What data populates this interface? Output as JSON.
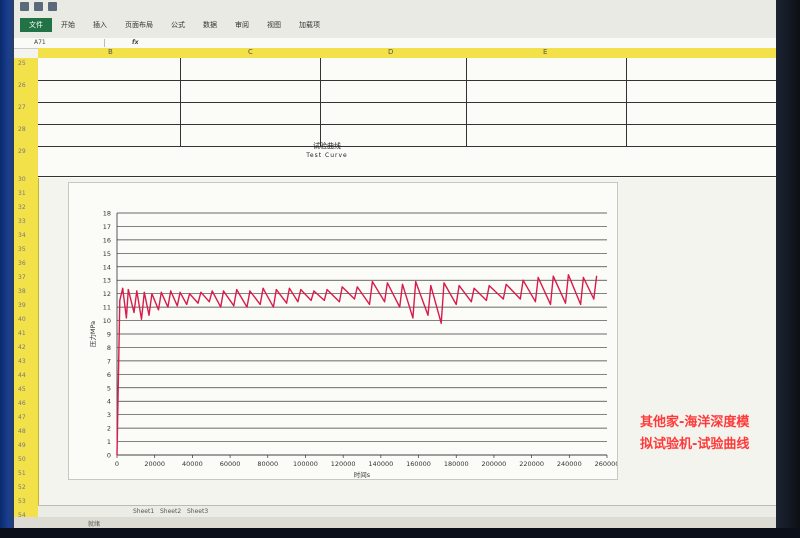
{
  "ribbon": {
    "tabs": [
      "文件",
      "开始",
      "插入",
      "页面布局",
      "公式",
      "数据",
      "审阅",
      "视图",
      "加载项"
    ]
  },
  "formula_bar": {
    "name_box": "A71",
    "fx": "fx"
  },
  "columns": [
    "B",
    "C",
    "D",
    "E"
  ],
  "rows": [
    "25",
    "26",
    "27",
    "28",
    "29",
    "30",
    "31",
    "32",
    "33",
    "34",
    "35",
    "36",
    "37",
    "38",
    "39",
    "40",
    "41",
    "42",
    "43",
    "44",
    "45",
    "46",
    "47",
    "48",
    "49",
    "50",
    "51",
    "52",
    "53",
    "54"
  ],
  "curve": {
    "title_cn": "试验曲线",
    "title_en": "Test Curve"
  },
  "sheets": [
    "Sheet1",
    "Sheet2",
    "Sheet3"
  ],
  "status": {
    "ready": "就绪"
  },
  "watermark": {
    "line1": "其他家-海洋深度模",
    "line2": "拟试验机-试验曲线"
  },
  "colors": {
    "line": "#d81b4a",
    "header": "#f3e14a",
    "watermark": "#ff3a3a"
  },
  "chart_data": {
    "type": "line",
    "ylabel": "压力MPa",
    "xlabel": "时间s",
    "ylim": [
      0,
      18
    ],
    "xlim": [
      0,
      260000
    ],
    "yticks": [
      "0",
      "1",
      "2",
      "3",
      "4",
      "5",
      "6",
      "7",
      "8",
      "9",
      "10",
      "11",
      "12",
      "13",
      "14",
      "15",
      "16",
      "17",
      "18"
    ],
    "xticks": [
      "0",
      "20000",
      "40000",
      "60000",
      "80000",
      "100000",
      "120000",
      "140000",
      "160000",
      "180000",
      "200000",
      "220000",
      "240000",
      "260000"
    ],
    "series": [
      {
        "values": [
          [
            0,
            0
          ],
          [
            1500,
            11.5
          ],
          [
            3000,
            12.4
          ],
          [
            5000,
            10.2
          ],
          [
            6000,
            12.3
          ],
          [
            9000,
            10.6
          ],
          [
            10500,
            12.2
          ],
          [
            13000,
            10.1
          ],
          [
            14500,
            12.1
          ],
          [
            17000,
            10.4
          ],
          [
            18500,
            12.0
          ],
          [
            22000,
            10.8
          ],
          [
            23500,
            12.1
          ],
          [
            27000,
            11.0
          ],
          [
            28500,
            12.2
          ],
          [
            32000,
            11.1
          ],
          [
            33500,
            12.1
          ],
          [
            37000,
            11.2
          ],
          [
            38500,
            12.0
          ],
          [
            43000,
            11.3
          ],
          [
            44500,
            12.1
          ],
          [
            49000,
            11.4
          ],
          [
            50500,
            12.2
          ],
          [
            55000,
            11.0
          ],
          [
            56500,
            12.2
          ],
          [
            62000,
            11.1
          ],
          [
            63500,
            12.3
          ],
          [
            69000,
            11.0
          ],
          [
            70500,
            12.2
          ],
          [
            76000,
            11.2
          ],
          [
            77500,
            12.4
          ],
          [
            83000,
            11.0
          ],
          [
            84500,
            12.3
          ],
          [
            90000,
            11.3
          ],
          [
            91500,
            12.4
          ],
          [
            96000,
            11.4
          ],
          [
            97500,
            12.3
          ],
          [
            103000,
            11.5
          ],
          [
            104500,
            12.2
          ],
          [
            110000,
            11.5
          ],
          [
            111500,
            12.3
          ],
          [
            118000,
            11.4
          ],
          [
            119500,
            12.5
          ],
          [
            126000,
            11.6
          ],
          [
            127500,
            12.5
          ],
          [
            134000,
            11.2
          ],
          [
            135500,
            12.9
          ],
          [
            142000,
            11.4
          ],
          [
            143500,
            12.8
          ],
          [
            150000,
            11.0
          ],
          [
            151500,
            12.7
          ],
          [
            157000,
            10.2
          ],
          [
            158500,
            12.9
          ],
          [
            165000,
            10.4
          ],
          [
            166500,
            12.6
          ],
          [
            172000,
            9.8
          ],
          [
            173500,
            12.8
          ],
          [
            180000,
            11.2
          ],
          [
            181500,
            12.6
          ],
          [
            188000,
            11.4
          ],
          [
            189500,
            12.4
          ],
          [
            196000,
            11.5
          ],
          [
            197500,
            12.6
          ],
          [
            205000,
            11.6
          ],
          [
            206500,
            12.7
          ],
          [
            214000,
            11.6
          ],
          [
            215500,
            13.0
          ],
          [
            222000,
            11.4
          ],
          [
            223500,
            13.2
          ],
          [
            230000,
            11.2
          ],
          [
            231500,
            13.3
          ],
          [
            238000,
            11.3
          ],
          [
            239500,
            13.4
          ],
          [
            246000,
            11.2
          ],
          [
            247500,
            13.2
          ],
          [
            253000,
            11.6
          ],
          [
            254500,
            13.3
          ]
        ]
      }
    ]
  }
}
